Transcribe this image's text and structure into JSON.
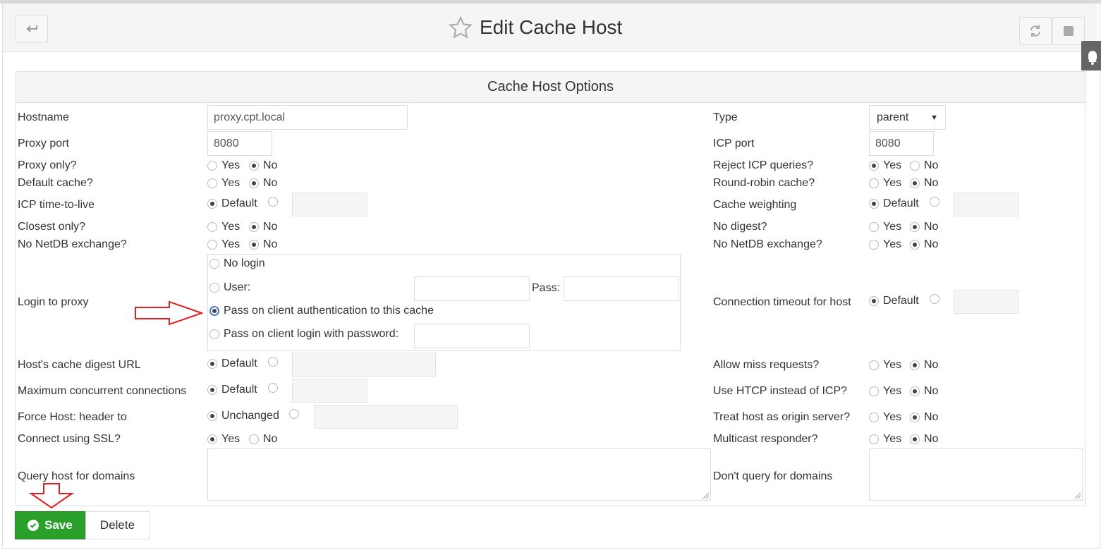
{
  "header": {
    "title": "Edit Cache Host"
  },
  "panel": {
    "title": "Cache Host Options"
  },
  "labels": {
    "yes": "Yes",
    "no": "No",
    "default": "Default",
    "unchanged": "Unchanged"
  },
  "fields": {
    "hostname": {
      "label": "Hostname",
      "value": "proxy.cpt.local"
    },
    "type": {
      "label": "Type",
      "value": "parent"
    },
    "proxy_port": {
      "label": "Proxy port",
      "value": "8080"
    },
    "icp_port": {
      "label": "ICP port",
      "value": "8080"
    },
    "proxy_only": {
      "label": "Proxy only?",
      "selected": "No"
    },
    "reject_icp": {
      "label": "Reject ICP queries?",
      "selected": "Yes"
    },
    "default_cache": {
      "label": "Default cache?",
      "selected": "No"
    },
    "round_robin": {
      "label": "Round-robin cache?",
      "selected": "No"
    },
    "icp_ttl": {
      "label": "ICP time-to-live",
      "selected": "Default"
    },
    "cache_weighting": {
      "label": "Cache weighting",
      "selected": "Default"
    },
    "closest_only": {
      "label": "Closest only?",
      "selected": "No"
    },
    "no_digest": {
      "label": "No digest?",
      "selected": "No"
    },
    "no_netdb_left": {
      "label": "No NetDB exchange?",
      "selected": "No"
    },
    "no_netdb_right": {
      "label": "No NetDB exchange?",
      "selected": "No"
    },
    "login": {
      "label": "Login to proxy",
      "no_login": "No login",
      "user": "User:",
      "pass": "Pass:",
      "pass_client_auth": "Pass on client authentication to this cache",
      "pass_client_login": "Pass on client login with password:",
      "selected": "Pass on client authentication to this cache"
    },
    "conn_timeout": {
      "label": "Connection timeout for host",
      "selected": "Default"
    },
    "digest_url": {
      "label": "Host's cache digest URL",
      "selected": "Default"
    },
    "allow_miss": {
      "label": "Allow miss requests?",
      "selected": "No"
    },
    "max_conn": {
      "label": "Maximum concurrent connections",
      "selected": "Default"
    },
    "use_htcp": {
      "label": "Use HTCP instead of ICP?",
      "selected": "No"
    },
    "force_host": {
      "label": "Force Host: header to",
      "selected": "Unchanged"
    },
    "origin_server": {
      "label": "Treat host as origin server?",
      "selected": "No"
    },
    "connect_ssl": {
      "label": "Connect using SSL?",
      "selected": "Yes"
    },
    "multicast": {
      "label": "Multicast responder?",
      "selected": "No"
    },
    "query_domains": {
      "label": "Query host for domains"
    },
    "dont_query_domains": {
      "label": "Don't query for domains"
    }
  },
  "buttons": {
    "save": "Save",
    "delete": "Delete"
  },
  "colors": {
    "save": "#2a9f2a",
    "annotation_arrow": "#e02020"
  }
}
